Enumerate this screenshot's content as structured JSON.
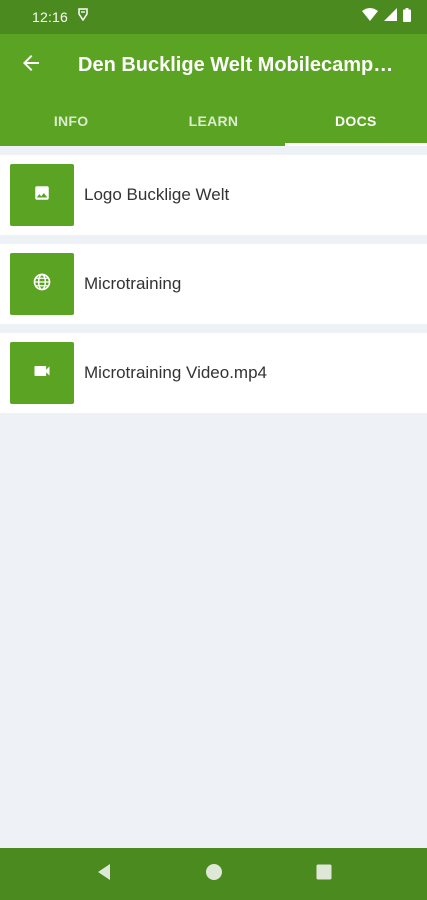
{
  "status_bar": {
    "time": "12:16",
    "icons": [
      "notification-icon",
      "wifi-icon",
      "signal-icon",
      "battery-icon"
    ]
  },
  "app_bar": {
    "back_icon": "arrow-left-icon",
    "title": "Den Bucklige Welt Mobilecamp…"
  },
  "tabs": [
    {
      "label": "INFO",
      "active": false
    },
    {
      "label": "LEARN",
      "active": false
    },
    {
      "label": "DOCS",
      "active": true
    }
  ],
  "documents": [
    {
      "label": "Logo Bucklige Welt",
      "icon": "image-icon"
    },
    {
      "label": "Microtraining",
      "icon": "globe-icon"
    },
    {
      "label": "Microtraining Video.mp4",
      "icon": "video-icon"
    }
  ],
  "nav_bar": {
    "buttons": [
      "back-triangle-icon",
      "home-circle-icon",
      "recents-square-icon"
    ]
  },
  "colors": {
    "primary": "#5ba323",
    "primary_dark": "#4a8a1e",
    "background": "#eef2f7"
  }
}
